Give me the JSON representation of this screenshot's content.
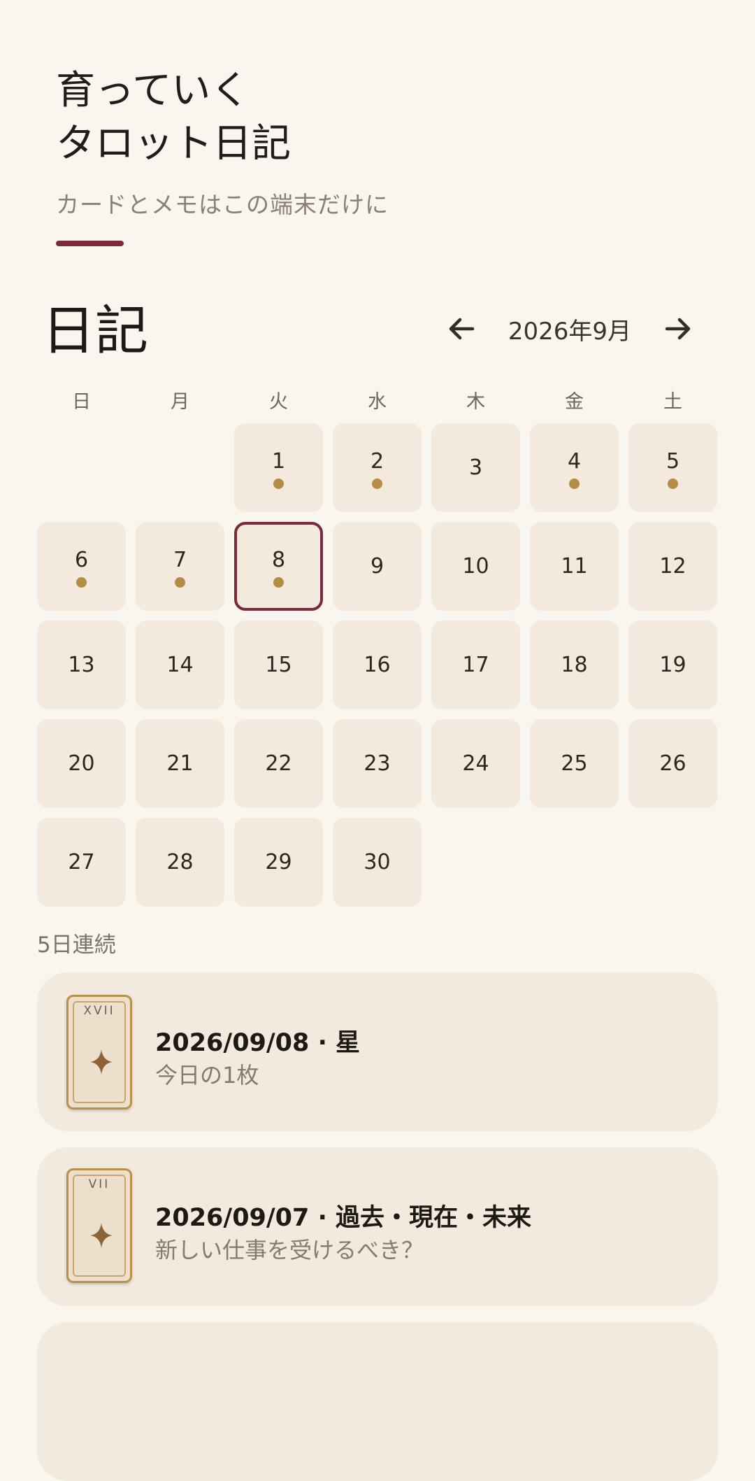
{
  "header": {
    "title": "育っていく\nタロット日記",
    "subtitle": "カードとメモはこの端末だけに",
    "accent_color": "#7c2a3a"
  },
  "diary": {
    "section_title": "日記",
    "month_label": "2026年9月",
    "prev_icon": "arrow-left-icon",
    "next_icon": "arrow-right-icon",
    "weekdays": [
      "日",
      "月",
      "火",
      "水",
      "木",
      "金",
      "土"
    ],
    "days": [
      {
        "label": ""
      },
      {
        "label": ""
      },
      {
        "label": "1",
        "dot": true
      },
      {
        "label": "2",
        "dot": true
      },
      {
        "label": "3"
      },
      {
        "label": "4",
        "dot": true
      },
      {
        "label": "5",
        "dot": true
      },
      {
        "label": "6",
        "dot": true
      },
      {
        "label": "7",
        "dot": true
      },
      {
        "label": "8",
        "dot": true,
        "selected": true
      },
      {
        "label": "9"
      },
      {
        "label": "10"
      },
      {
        "label": "11"
      },
      {
        "label": "12"
      },
      {
        "label": "13"
      },
      {
        "label": "14"
      },
      {
        "label": "15"
      },
      {
        "label": "16"
      },
      {
        "label": "17"
      },
      {
        "label": "18"
      },
      {
        "label": "19"
      },
      {
        "label": "20"
      },
      {
        "label": "21"
      },
      {
        "label": "22"
      },
      {
        "label": "23"
      },
      {
        "label": "24"
      },
      {
        "label": "25"
      },
      {
        "label": "26"
      },
      {
        "label": "27"
      },
      {
        "label": "28"
      },
      {
        "label": "29"
      },
      {
        "label": "30"
      }
    ],
    "dot_color": "#b58c45",
    "streak": "5日連続"
  },
  "entries": [
    {
      "numeral": "XVII",
      "title": "2026/09/08 · 星",
      "subtitle": "今日の1枚",
      "icon": "sparkle-icon"
    },
    {
      "numeral": "VII",
      "title": "2026/09/07 · 過去・現在・未来",
      "subtitle": "新しい仕事を受けるべき？",
      "icon": "sparkle-icon"
    }
  ]
}
